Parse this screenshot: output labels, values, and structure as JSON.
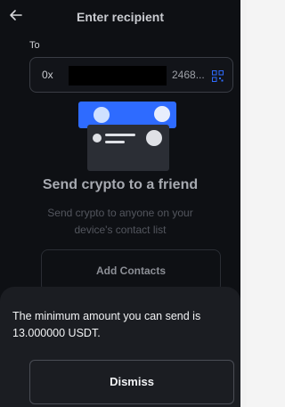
{
  "header": {
    "title": "Enter recipient",
    "back_icon": "arrow-left-icon"
  },
  "recipient": {
    "label": "To",
    "address_prefix": "0x",
    "address_suffix": "2468...",
    "qr_icon": "qr-code-icon"
  },
  "empty_state": {
    "heading": "Send crypto to a friend",
    "subtitle": "Send crypto to anyone on your device's contact list",
    "add_contacts_label": "Add Contacts"
  },
  "sheet": {
    "message": "The minimum amount you can send is 13.000000 USDT.",
    "dismiss_label": "Dismiss"
  },
  "colors": {
    "background": "#0e1014",
    "sheet": "#1b1d22",
    "accent": "#2e6bff"
  }
}
